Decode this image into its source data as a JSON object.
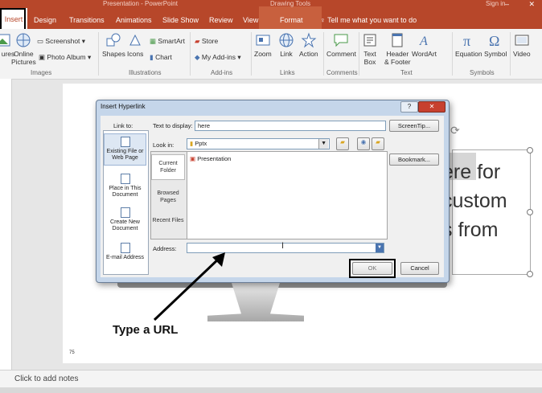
{
  "window": {
    "title": "Presentation - PowerPoint",
    "context_group": "Drawing Tools",
    "sign_in": "Sign in",
    "controls": "–  ❐  ✕"
  },
  "tabs": [
    "Insert",
    "Design",
    "Transitions",
    "Animations",
    "Slide Show",
    "Review",
    "View",
    "Format"
  ],
  "tell_me": "Tell me what you want to do",
  "ribbon": {
    "images": {
      "pictures": "ures",
      "online": "Online\nPictures",
      "screenshot": "Screenshot",
      "album": "Photo Album",
      "group": "Images"
    },
    "illustrations": {
      "shapes": "Shapes",
      "icons": "Icons",
      "smartart": "SmartArt",
      "chart": "Chart",
      "group": "Illustrations"
    },
    "addins": {
      "store": "Store",
      "myaddins": "My Add-ins",
      "group": "Add-ins"
    },
    "links": {
      "zoom": "Zoom",
      "link": "Link",
      "action": "Action",
      "group": "Links"
    },
    "comments": {
      "comment": "Comment",
      "group": "Comments"
    },
    "text": {
      "textbox": "Text\nBox",
      "header": "Header\n& Footer",
      "wordart": "WordArt",
      "group": "Text"
    },
    "symbols": {
      "equation": "Equation",
      "symbol": "Symbol",
      "group": "Symbols"
    },
    "media": {
      "video": "Video"
    }
  },
  "slide": {
    "text_lines": [
      "ere for",
      "custom",
      "s from"
    ],
    "slide_number": "75"
  },
  "notes_placeholder": "Click to add notes",
  "dialog": {
    "title": "Insert Hyperlink",
    "help": "?",
    "close": "✕",
    "link_to_label": "Link to:",
    "text_to_display_label": "Text to display:",
    "text_to_display_value": "here",
    "screentip": "ScreenTip...",
    "look_in_label": "Look in:",
    "look_in_value": "Pptx",
    "bookmark": "Bookmark...",
    "link_to_items": [
      "Existing File or Web Page",
      "Place in This Document",
      "Create New Document",
      "E-mail Address"
    ],
    "look_in_items": [
      "Current Folder",
      "Browsed Pages",
      "Recent Files"
    ],
    "files": [
      "Presentation"
    ],
    "address_label": "Address:",
    "address_value": "",
    "ok": "OK",
    "cancel": "Cancel"
  },
  "annotation": "Type a URL",
  "colors": {
    "accent": "#b7472a",
    "dialog_frame": "#c5d6ea",
    "close_red": "#c7402f"
  }
}
